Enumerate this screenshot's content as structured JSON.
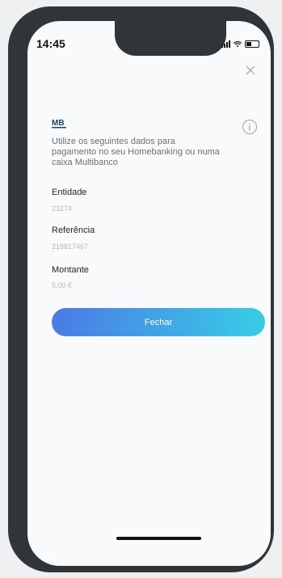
{
  "status_bar": {
    "time": "14:45"
  },
  "payment": {
    "description": "Utilize os seguintes dados para pagamento no seu Homebanking ou numa caixa Multibanco",
    "logo_text": "MB",
    "fields": [
      {
        "label": "Entidade",
        "value": "23274"
      },
      {
        "label": "Referência",
        "value": "218817467"
      },
      {
        "label": "Montante",
        "value": "5,00 €"
      }
    ],
    "close_button_label": "Fechar"
  },
  "colors": {
    "button_gradient_start": "#4b7ae6",
    "button_gradient_end": "#38cde6",
    "frame": "#2f3538"
  },
  "icons": [
    "close-icon",
    "info-icon",
    "multibanco-logo",
    "signal-icon",
    "wifi-icon",
    "battery-icon"
  ]
}
